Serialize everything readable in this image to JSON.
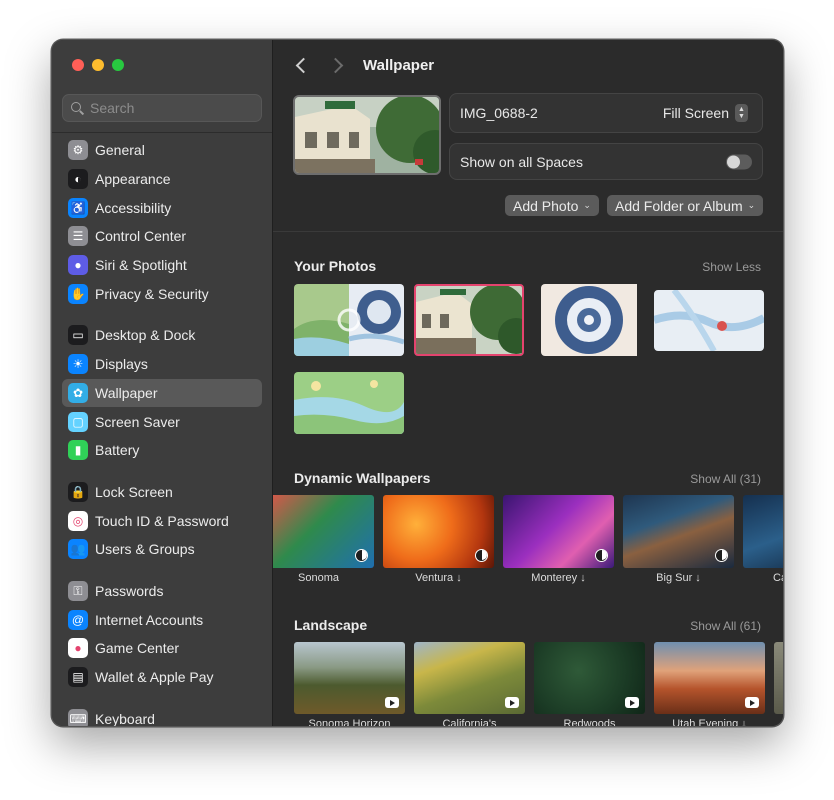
{
  "window": {
    "title": "Wallpaper"
  },
  "search": {
    "placeholder": "Search"
  },
  "sidebar": {
    "groups": [
      [
        {
          "label": "General",
          "icon": "gear-icon",
          "color": "#8e8e93"
        },
        {
          "label": "Appearance",
          "icon": "appearance-icon",
          "color": "#1c1c1e"
        },
        {
          "label": "Accessibility",
          "icon": "accessibility-icon",
          "color": "#0a84ff"
        },
        {
          "label": "Control Center",
          "icon": "control-center-icon",
          "color": "#8e8e93"
        },
        {
          "label": "Siri & Spotlight",
          "icon": "siri-icon",
          "color": "#5e5ce6"
        },
        {
          "label": "Privacy & Security",
          "icon": "hand-icon",
          "color": "#0a84ff"
        }
      ],
      [
        {
          "label": "Desktop & Dock",
          "icon": "dock-icon",
          "color": "#1c1c1e"
        },
        {
          "label": "Displays",
          "icon": "sun-icon",
          "color": "#0a84ff"
        },
        {
          "label": "Wallpaper",
          "icon": "wallpaper-icon",
          "color": "#32ade6",
          "active": true
        },
        {
          "label": "Screen Saver",
          "icon": "screen-saver-icon",
          "color": "#64d2ff"
        },
        {
          "label": "Battery",
          "icon": "battery-icon",
          "color": "#30d158"
        }
      ],
      [
        {
          "label": "Lock Screen",
          "icon": "lock-icon",
          "color": "#1c1c1e"
        },
        {
          "label": "Touch ID & Password",
          "icon": "fingerprint-icon",
          "color": "#ffffff"
        },
        {
          "label": "Users & Groups",
          "icon": "users-icon",
          "color": "#0a84ff"
        }
      ],
      [
        {
          "label": "Passwords",
          "icon": "key-icon",
          "color": "#8e8e93"
        },
        {
          "label": "Internet Accounts",
          "icon": "at-icon",
          "color": "#0a84ff"
        },
        {
          "label": "Game Center",
          "icon": "game-center-icon",
          "color": "#ffffff"
        },
        {
          "label": "Wallet & Apple Pay",
          "icon": "wallet-icon",
          "color": "#1c1c1e"
        }
      ],
      [
        {
          "label": "Keyboard",
          "icon": "keyboard-icon",
          "color": "#8e8e93"
        }
      ]
    ]
  },
  "current": {
    "name": "IMG_0688-2",
    "fit": "Fill Screen",
    "all_spaces_label": "Show on all Spaces",
    "all_spaces_on": false
  },
  "actions": {
    "add_photo": "Add Photo",
    "add_folder": "Add Folder or Album"
  },
  "your_photos": {
    "title": "Your Photos",
    "link": "Show Less"
  },
  "dynamic": {
    "title": "Dynamic Wallpapers",
    "link": "Show All (31)",
    "items": [
      {
        "label": "Sonoma"
      },
      {
        "label": "Ventura ↓"
      },
      {
        "label": "Monterey ↓"
      },
      {
        "label": "Big Sur ↓"
      },
      {
        "label": "Ca"
      }
    ]
  },
  "landscape": {
    "title": "Landscape",
    "link": "Show All (61)",
    "items": [
      {
        "label": "Sonoma Horizon"
      },
      {
        "label": "California's"
      },
      {
        "label": "Redwoods"
      },
      {
        "label": "Utah Evening ↓"
      }
    ]
  },
  "colors": {
    "accent": "#e4436e",
    "sidebar_active": "#595959"
  }
}
